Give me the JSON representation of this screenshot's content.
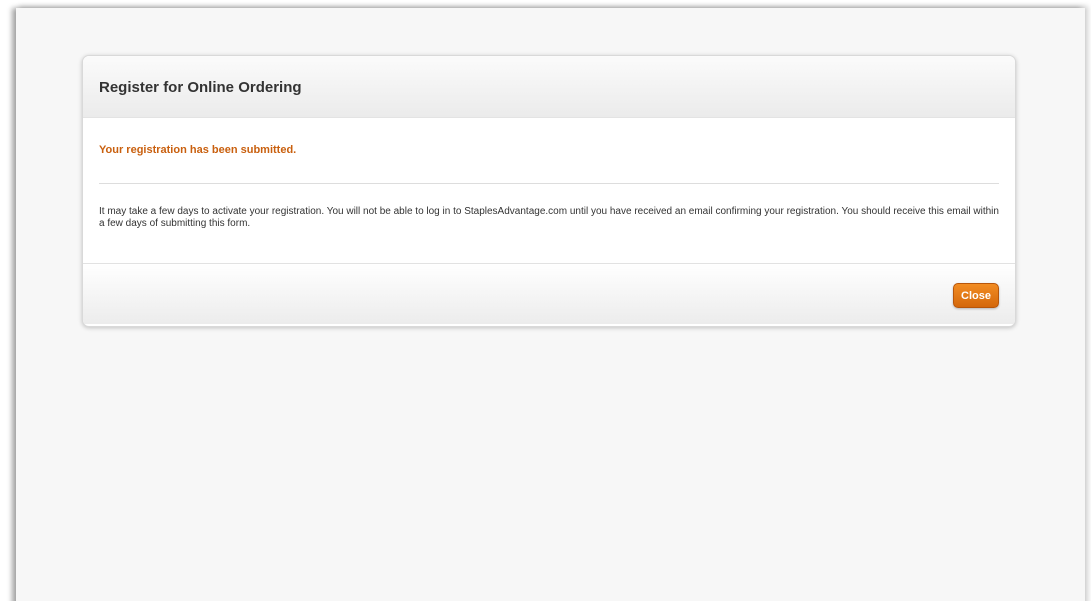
{
  "dialog": {
    "title": "Register for Online Ordering",
    "success_message": "Your registration has been submitted.",
    "info_text": "It may take a few days to activate your registration. You will not be able to log in to StaplesAdvantage.com until you have received an email confirming your registration. You should receive this email within a few days of submitting this form.",
    "close_label": "Close"
  },
  "colors": {
    "accent": "#c9600f",
    "button": "#e07a16"
  }
}
